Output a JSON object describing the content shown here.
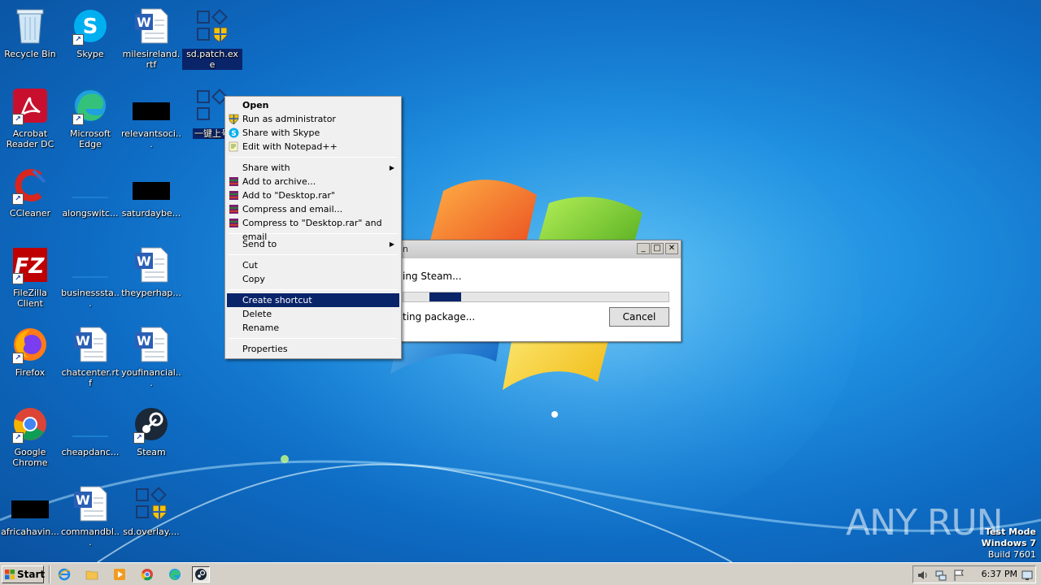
{
  "desktop": {
    "icons": [
      {
        "label": "Recycle Bin",
        "icon": "recycle-bin-icon"
      },
      {
        "label": "Skype",
        "icon": "skype-icon"
      },
      {
        "label": "milesireland.rtf",
        "icon": "word-doc-icon"
      },
      {
        "label": "sd.patch.exe",
        "icon": "exe-app-icon"
      },
      {
        "label": "Acrobat Reader DC",
        "icon": "acrobat-icon"
      },
      {
        "label": "Microsoft Edge",
        "icon": "edge-icon"
      },
      {
        "label": "relevantsoci...",
        "icon": "black-thumbnail-icon"
      },
      {
        "label": "一键上号",
        "icon": "exe-app-icon"
      },
      {
        "label": "CCleaner",
        "icon": "ccleaner-icon"
      },
      {
        "label": "alongswitc...",
        "icon": "folder-icon"
      },
      {
        "label": "saturdaybe...",
        "icon": "black-thumbnail-icon"
      },
      {
        "label": "FileZilla Client",
        "icon": "filezilla-icon"
      },
      {
        "label": "businessstа...",
        "icon": "folder-icon"
      },
      {
        "label": "theyperhap...",
        "icon": "word-doc-icon"
      },
      {
        "label": "Firefox",
        "icon": "firefox-icon"
      },
      {
        "label": "chatcenter.rtf",
        "icon": "word-doc-icon"
      },
      {
        "label": "youfinancial...",
        "icon": "word-doc-icon"
      },
      {
        "label": "Google Chrome",
        "icon": "chrome-icon"
      },
      {
        "label": "cheapdanc...",
        "icon": "folder-icon"
      },
      {
        "label": "Steam",
        "icon": "steam-icon"
      },
      {
        "label": "africahavin...",
        "icon": "black-thumbnail-icon"
      },
      {
        "label": "commandbl...",
        "icon": "word-doc-icon"
      },
      {
        "label": "sd.overlay....",
        "icon": "exe-app-icon"
      }
    ]
  },
  "context_menu": {
    "items": [
      {
        "label": "Open",
        "icon": "none"
      },
      {
        "label": "Run as administrator",
        "icon": "uac-shield-icon"
      },
      {
        "label": "Share with Skype",
        "icon": "skype-icon"
      },
      {
        "label": "Edit with Notepad++",
        "icon": "notepadpp-icon"
      },
      {
        "label": "Share with",
        "icon": "none"
      },
      {
        "label": "Add to archive...",
        "icon": "winrar-icon"
      },
      {
        "label": "Add to \"Desktop.rar\"",
        "icon": "winrar-icon"
      },
      {
        "label": "Compress and email...",
        "icon": "winrar-icon"
      },
      {
        "label": "Compress to \"Desktop.rar\" and email",
        "icon": "winrar-icon"
      },
      {
        "label": "Send to",
        "icon": "none"
      },
      {
        "label": "Cut",
        "icon": "none"
      },
      {
        "label": "Copy",
        "icon": "none"
      },
      {
        "label": "Create shortcut",
        "icon": "none"
      },
      {
        "label": "Delete",
        "icon": "none"
      },
      {
        "label": "Rename",
        "icon": "none"
      },
      {
        "label": "Properties",
        "icon": "none"
      }
    ]
  },
  "dialog": {
    "title": "n",
    "line1": "ing Steam...",
    "line2": "ting package...",
    "cancel_label": "Cancel",
    "progress": 0.12,
    "min_label": "_",
    "max_label": "□",
    "close_label": "✕"
  },
  "watermark": {
    "text": "ANY RUN"
  },
  "os_badge": {
    "line1": "Test Mode",
    "line2": "Windows 7",
    "line3": "Build 7601"
  },
  "taskbar": {
    "start_label": "Start",
    "clock": "6:37 PM",
    "pinned": [
      "ie-icon",
      "explorer-icon",
      "media-player-icon",
      "chrome-icon",
      "edge-icon",
      "steam-icon"
    ]
  },
  "colors": {
    "selection": "#0a246a",
    "taskbar": "#d4d0c8"
  }
}
